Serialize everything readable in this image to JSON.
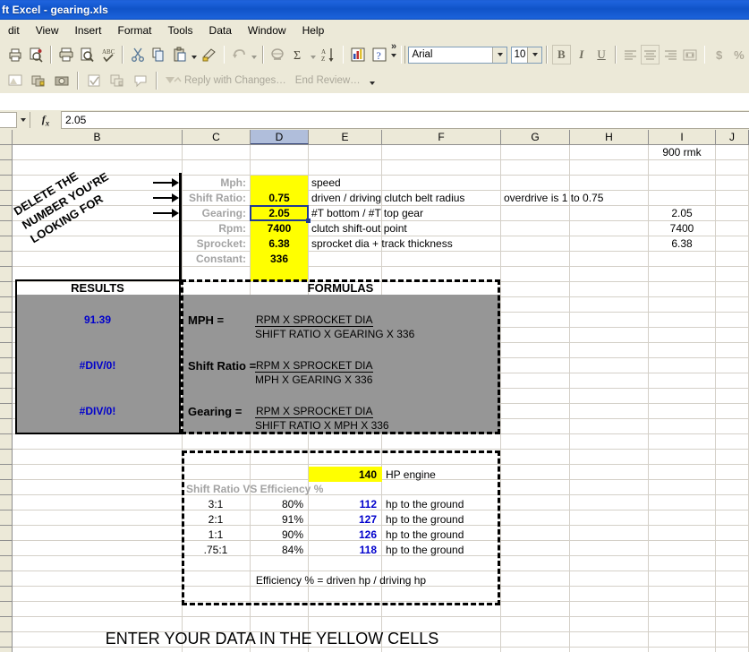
{
  "window": {
    "title": "ft Excel - gearing.xls"
  },
  "menu": {
    "items": [
      "dit",
      "View",
      "Insert",
      "Format",
      "Tools",
      "Data",
      "Window",
      "Help"
    ]
  },
  "toolbar": {
    "row1_icons": [
      "print-preview-small-icon",
      "search-document-icon",
      "print-icon",
      "print-preview-icon",
      "spelling-check-icon",
      "cut-icon",
      "copy-icon",
      "paste-icon",
      "format-painter-icon",
      "undo-icon",
      "hyperlink-icon",
      "autosum-icon",
      "sort-ascending-icon",
      "chart-wizard-icon",
      "help-icon",
      "toolbar-overflow-icon"
    ],
    "row2_icons": [
      "drawing-icon",
      "copy-sheets-icon",
      "camera-icon",
      "check-icon",
      "compare-merge-icon",
      "comment-icon",
      "reply-icon"
    ],
    "reply_with_changes_label": "Reply with Changes…",
    "end_review_label": "End Review…",
    "font_name": "Arial",
    "font_size": "10",
    "bold_label": "B",
    "italic_label": "I",
    "underline_label": "U",
    "currency_label": "$",
    "percent_label": "%"
  },
  "formula_bar": {
    "name_box_value": "",
    "fx_label": "fx",
    "value": "2.05"
  },
  "grid": {
    "columns": [
      "B",
      "C",
      "D",
      "E",
      "F",
      "G",
      "H",
      "I",
      "J"
    ],
    "selected_column": "D"
  },
  "sheet": {
    "annotation": {
      "line1": "DELETE THE",
      "line2": "NUMBER YOU'RE",
      "line3": "LOOKING FOR"
    },
    "inputs": [
      {
        "label": "Mph:",
        "value": "",
        "note": "speed"
      },
      {
        "label": "Shift Ratio:",
        "value": "0.75",
        "note": "driven / driving clutch belt radius"
      },
      {
        "label": "Gearing:",
        "value": "2.05",
        "note": "#T bottom / #T top gear"
      },
      {
        "label": "Rpm:",
        "value": "7400",
        "note": "clutch shift-out point"
      },
      {
        "label": "Sprocket:",
        "value": "6.38",
        "note": "sprocket dia + track thickness"
      },
      {
        "label": "Constant:",
        "value": "336",
        "note": ""
      }
    ],
    "overdrive_note": "overdrive is 1 to 0.75",
    "col_i": {
      "rmk": "900 rmk",
      "gearing": "2.05",
      "rpm": "7400",
      "sprocket": "6.38"
    },
    "results_panel": {
      "results_header": "RESULTS",
      "formulas_header": "FORMULAS",
      "rows": [
        {
          "result": "91.39",
          "name": "MPH =",
          "numerator": "RPM X SPROCKET DIA",
          "denominator": "SHIFT RATIO X GEARING X 336"
        },
        {
          "result": "#DIV/0!",
          "name": "Shift Ratio =",
          "numerator": "RPM X SPROCKET DIA",
          "denominator": "MPH X GEARING X 336"
        },
        {
          "result": "#DIV/0!",
          "name": "Gearing =",
          "numerator": "RPM X SPROCKET DIA",
          "denominator": "SHIFT RATIO X MPH X 336"
        }
      ]
    },
    "efficiency_panel": {
      "hp_value": "140",
      "hp_label": "HP engine",
      "table_title": "Shift Ratio VS Efficiency %",
      "rows": [
        {
          "ratio": "3:1",
          "efficiency": "80%",
          "hp": "112",
          "suffix": "hp to the ground"
        },
        {
          "ratio": "2:1",
          "efficiency": "91%",
          "hp": "127",
          "suffix": "hp to the ground"
        },
        {
          "ratio": "1:1",
          "efficiency": "90%",
          "hp": "126",
          "suffix": "hp to the ground"
        },
        {
          "ratio": ".75:1",
          "efficiency": "84%",
          "hp": "118",
          "suffix": "hp to the ground"
        }
      ],
      "footnote": "Efficiency % = driven hp / driving hp"
    },
    "footer_note": "ENTER YOUR DATA IN THE YELLOW CELLS"
  },
  "colors": {
    "title_blue": "#0a51c8",
    "input_yellow": "#ffff00",
    "result_blue": "#0000cc",
    "panel_gray": "#969696",
    "label_gray": "#a3a3a3"
  }
}
